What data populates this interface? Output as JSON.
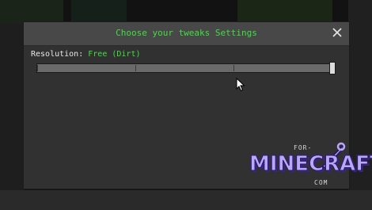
{
  "dialog": {
    "title": "Choose your tweaks Settings",
    "close_icon": "close-icon"
  },
  "setting": {
    "label": "Resolution:",
    "value": "Free (Dirt)"
  },
  "slider": {
    "position_fraction": 1.0,
    "tick_count": 4
  },
  "watermark": {
    "top": "FOR-",
    "main": "MINECRAFT",
    "bottom": "COM",
    "icon": "sword-icon"
  },
  "colors": {
    "accent_green": "#3ee03e",
    "dialog_bg": "#313131",
    "titlebar_bg": "#484848",
    "watermark_purple": "#b9a8f5"
  }
}
